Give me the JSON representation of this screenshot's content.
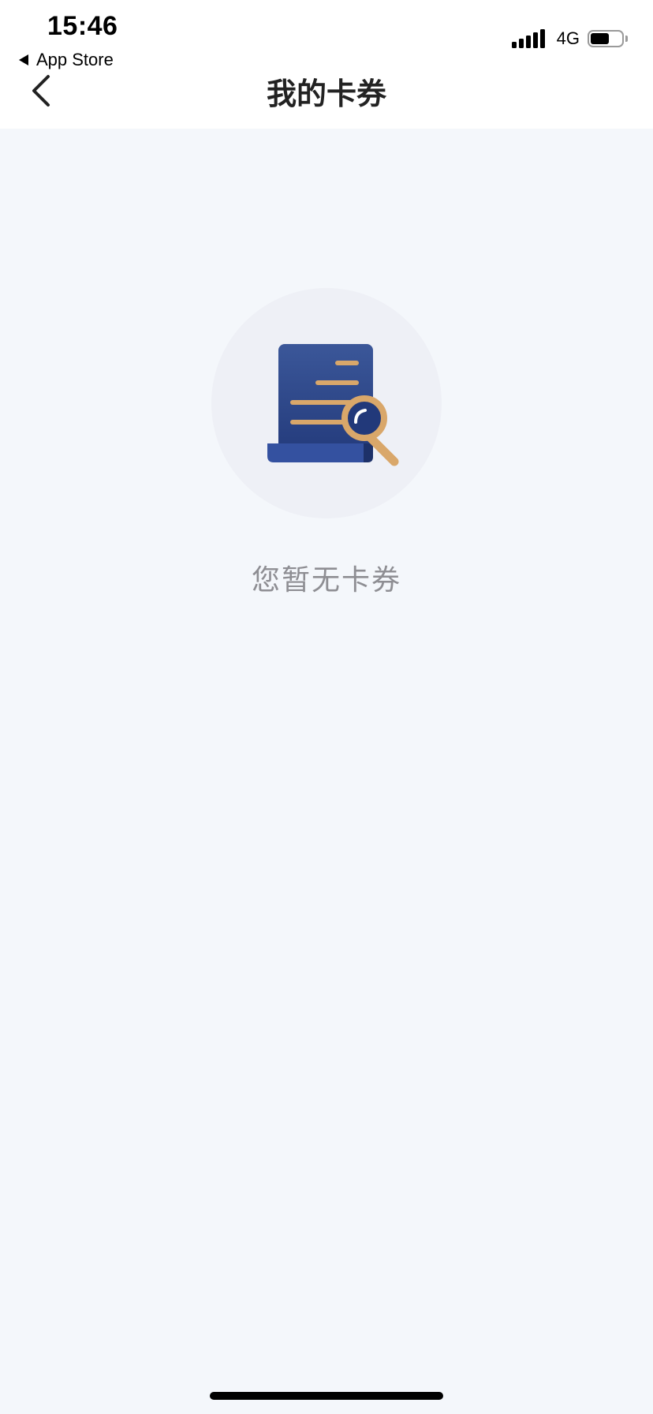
{
  "status_bar": {
    "time": "15:46",
    "back_app_label": "App Store",
    "network": "4G",
    "battery_level": 0.6
  },
  "header": {
    "title": "我的卡券",
    "back_icon": "chevron-left-icon"
  },
  "empty_state": {
    "icon": "document-search-icon",
    "message": "您暂无卡券"
  },
  "colors": {
    "header_bg": "#ffffff",
    "page_bg": "#f4f7fb",
    "illustration_circle": "#eef0f6",
    "document_blue": "#2e4a8e",
    "accent_gold": "#d9a76a",
    "empty_text": "#8e8e93"
  }
}
